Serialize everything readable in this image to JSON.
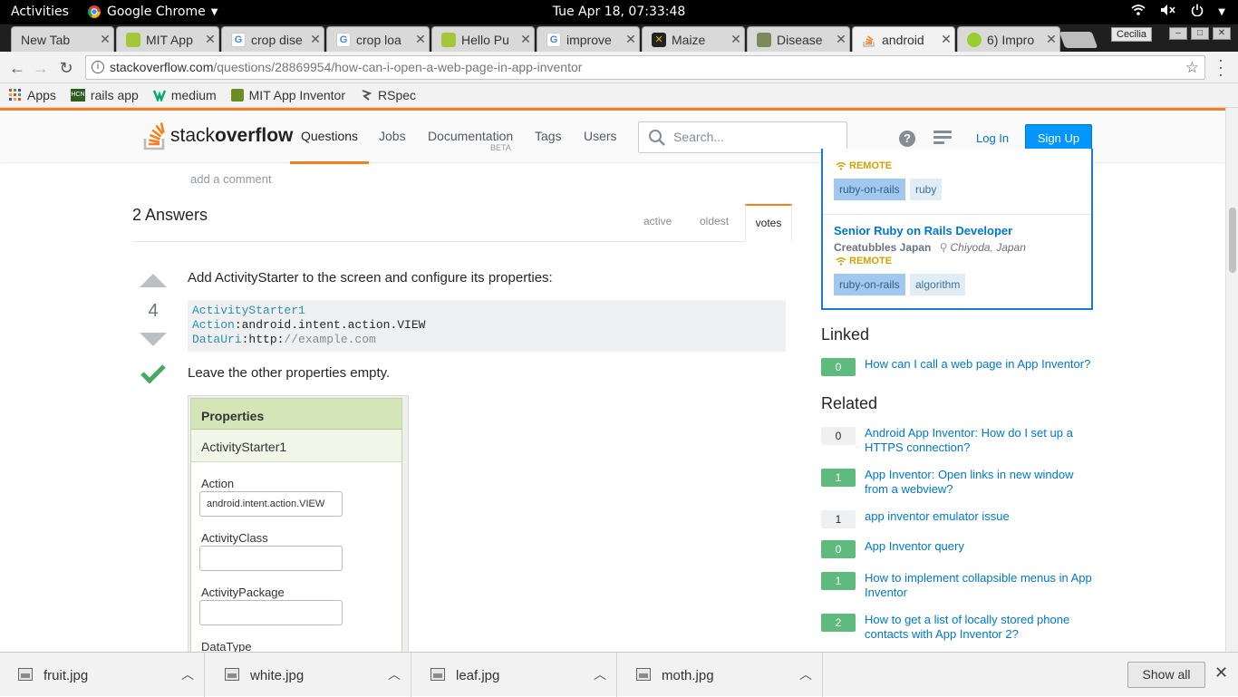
{
  "system": {
    "activities": "Activities",
    "app_name": "Google Chrome",
    "clock": "Tue Apr 18, 07:33:48"
  },
  "tabs": [
    {
      "title": "New Tab",
      "icon": "none"
    },
    {
      "title": "MIT App",
      "icon": "android-icon"
    },
    {
      "title": "crop dise",
      "icon": "google-icon"
    },
    {
      "title": "crop loa",
      "icon": "google-icon"
    },
    {
      "title": "Hello Pu",
      "icon": "android-icon"
    },
    {
      "title": "improve",
      "icon": "google-icon"
    },
    {
      "title": "Maize",
      "icon": "maize-icon"
    },
    {
      "title": "Disease",
      "icon": "image-icon"
    },
    {
      "title": "android",
      "icon": "stackoverflow-icon"
    },
    {
      "title": "6) Impro",
      "icon": "ball-icon"
    }
  ],
  "profile_name": "Cecilia",
  "url": {
    "host": "stackoverflow.com",
    "path": "/questions/28869954/how-can-i-open-a-web-page-in-app-inventor"
  },
  "bookmarks": [
    {
      "label": "Apps",
      "icon": "apps-grid-icon"
    },
    {
      "label": "rails app",
      "icon": "hcn-icon"
    },
    {
      "label": "medium",
      "icon": "medium-icon"
    },
    {
      "label": "MIT App Inventor",
      "icon": "mit-icon"
    },
    {
      "label": "RSpec",
      "icon": "rspec-icon"
    }
  ],
  "so": {
    "logo_text_light": "stack",
    "logo_text_bold": "overflow",
    "nav": {
      "questions": "Questions",
      "jobs": "Jobs",
      "documentation": "Documentation",
      "beta": "BETA",
      "tags": "Tags",
      "users": "Users"
    },
    "search_placeholder": "Search...",
    "login": "Log In",
    "signup": "Sign Up"
  },
  "question": {
    "add_comment": "add a comment"
  },
  "answers": {
    "title": "2 Answers",
    "sort": {
      "active": "active",
      "oldest": "oldest",
      "votes": "votes"
    },
    "first": {
      "votes": "4",
      "intro": "Add ActivityStarter to the screen and configure its properties:",
      "code": {
        "line1_key": "ActivityStarter1",
        "line2_key": "Action",
        "line2_val": ":android.intent.action.VIEW",
        "line3_key": "DataUri",
        "line3_val1": ":http:",
        "line3_val2": "//example.com"
      },
      "leave": "Leave the other properties empty.",
      "properties_panel": {
        "header": "Properties",
        "component": "ActivityStarter1",
        "fields": [
          {
            "label": "Action",
            "value": "android.intent.action.VIEW"
          },
          {
            "label": "ActivityClass",
            "value": ""
          },
          {
            "label": "ActivityPackage",
            "value": ""
          },
          {
            "label": "DataType",
            "value": ""
          }
        ]
      }
    }
  },
  "sidebar": {
    "jobs": {
      "remote_label": "REMOTE",
      "job1_tags": [
        "ruby-on-rails",
        "ruby"
      ],
      "job2_title": "Senior Ruby on Rails Developer",
      "job2_company": "Creatubbles Japan",
      "job2_location": "Chiyoda, Japan",
      "job2_tags": [
        "ruby-on-rails",
        "algorithm"
      ]
    },
    "linked_title": "Linked",
    "linked": [
      {
        "score": "0",
        "answered": true,
        "title": "How can I call a web page in App Inventor?"
      }
    ],
    "related_title": "Related",
    "related": [
      {
        "score": "0",
        "answered": false,
        "title": "Android App Inventor: How do I set up a HTTPS connection?"
      },
      {
        "score": "1",
        "answered": true,
        "title": "App Inventor: Open links in new window from a webview?"
      },
      {
        "score": "1",
        "answered": false,
        "title": "app inventor emulator issue"
      },
      {
        "score": "0",
        "answered": true,
        "title": "App Inventor query"
      },
      {
        "score": "1",
        "answered": true,
        "title": "How to implement collapsible menus in App Inventor"
      },
      {
        "score": "2",
        "answered": true,
        "title": "How to get a list of locally stored phone contacts with App Inventor 2?"
      }
    ]
  },
  "downloads": {
    "files": [
      "fruit.jpg",
      "white.jpg",
      "leaf.jpg",
      "moth.jpg"
    ],
    "show_all": "Show all"
  },
  "colors": {
    "so_orange": "#f48024",
    "so_blue": "#0077cc",
    "accepted_green": "#48a868",
    "answered_green": "#5eba7d"
  }
}
